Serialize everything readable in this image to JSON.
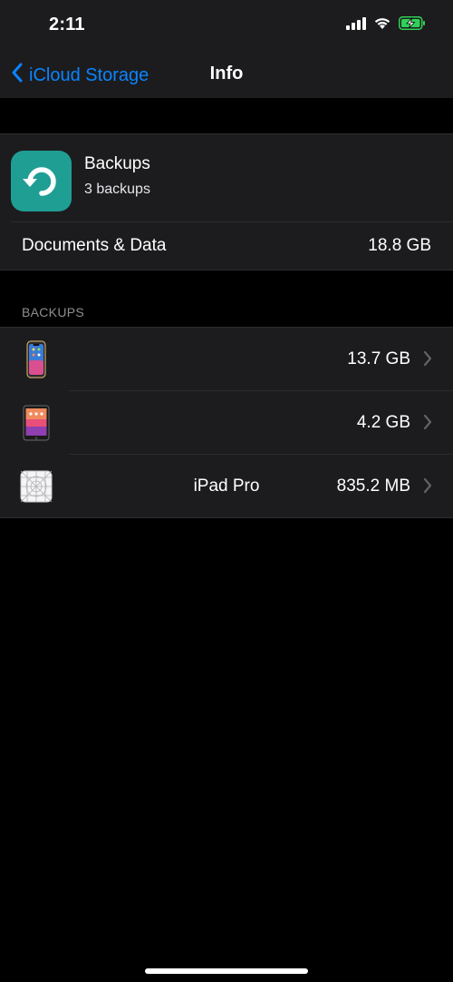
{
  "status_bar": {
    "time": "2:11",
    "icons": [
      "cellular-signal-icon",
      "wifi-icon",
      "battery-charging-icon"
    ],
    "battery_color": "#30d158"
  },
  "nav": {
    "back_label": "iCloud Storage",
    "title": "Info",
    "accent": "#0a84ff"
  },
  "app": {
    "name": "Backups",
    "subtitle": "3 backups",
    "icon": "backup-restore-icon",
    "icon_color": "#1f9e94"
  },
  "documents": {
    "label": "Documents & Data",
    "value": "18.8 GB"
  },
  "backups_section": {
    "header": "BACKUPS",
    "items": [
      {
        "name": "",
        "size": "13.7 GB",
        "icon": "iphone-icon"
      },
      {
        "name": "",
        "size": "4.2 GB",
        "icon": "ipad-icon"
      },
      {
        "name": "iPad Pro",
        "size": "835.2 MB",
        "icon": "ipad-pro-icon"
      }
    ]
  }
}
